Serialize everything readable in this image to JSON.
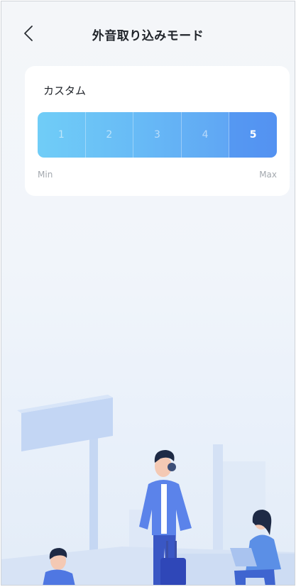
{
  "header": {
    "title": "外音取り込みモード",
    "back_icon": "chevron-left-icon"
  },
  "card": {
    "title": "カスタム",
    "levels": [
      "1",
      "2",
      "3",
      "4",
      "5"
    ],
    "selected_level": 5,
    "min_label": "Min",
    "max_label": "Max"
  },
  "colors": {
    "bar_start": "#70cdf7",
    "bar_end": "#5b9bf2",
    "page_bg": "#f4f6f9"
  }
}
